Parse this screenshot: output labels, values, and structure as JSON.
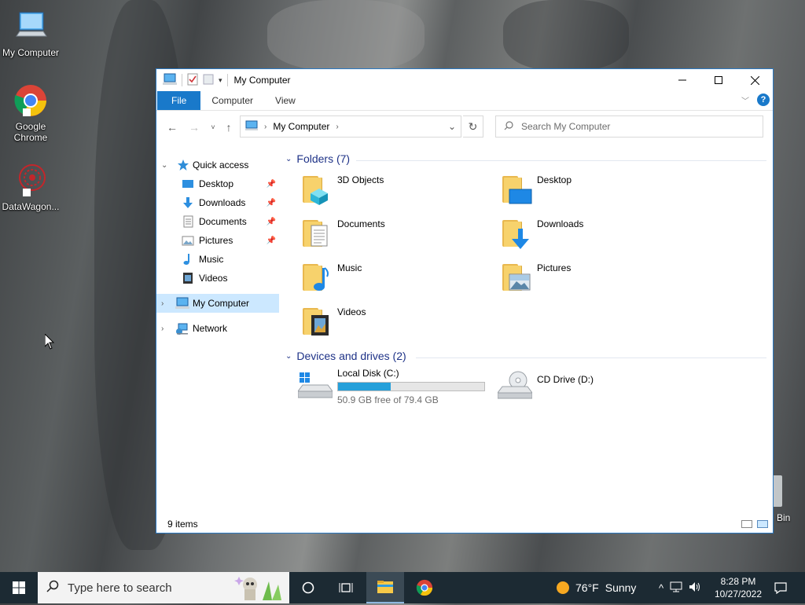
{
  "desktop": {
    "icons": [
      {
        "label": "My Computer"
      },
      {
        "label": "Google Chrome"
      },
      {
        "label": "DataWagon..."
      }
    ],
    "recycle_bin_label": "Bin"
  },
  "window": {
    "title": "My Computer",
    "ribbon_tabs": [
      "File",
      "Computer",
      "View"
    ],
    "help_glyph": "?",
    "address": {
      "segment": "My Computer"
    },
    "search_placeholder": "Search My Computer",
    "sidebar": {
      "quick_access": "Quick access",
      "items": [
        {
          "label": "Desktop",
          "pinned": true,
          "icon": "desktop-icon"
        },
        {
          "label": "Downloads",
          "pinned": true,
          "icon": "downloads-icon"
        },
        {
          "label": "Documents",
          "pinned": true,
          "icon": "documents-icon"
        },
        {
          "label": "Pictures",
          "pinned": true,
          "icon": "pictures-icon"
        },
        {
          "label": "Music",
          "pinned": false,
          "icon": "music-icon"
        },
        {
          "label": "Videos",
          "pinned": false,
          "icon": "videos-icon"
        }
      ],
      "my_computer": "My Computer",
      "network": "Network"
    },
    "content": {
      "folders_header": "Folders (7)",
      "folders": [
        "3D Objects",
        "Desktop",
        "Documents",
        "Downloads",
        "Music",
        "Pictures",
        "Videos"
      ],
      "drives_header": "Devices and drives (2)",
      "drives": [
        {
          "label": "Local Disk (C:)",
          "free_text": "50.9 GB free of 79.4 GB",
          "used_fraction": 0.36
        },
        {
          "label": "CD Drive (D:)"
        }
      ]
    },
    "status": "9 items"
  },
  "taskbar": {
    "search_placeholder": "Type here to search",
    "weather_temp": "76°F",
    "weather_cond": "Sunny",
    "time": "8:28 PM",
    "date": "10/27/2022"
  },
  "colors": {
    "accent": "#1979ca",
    "selection": "#cce8ff",
    "drive_fill": "#26a0da",
    "group_header": "#1e3287"
  }
}
